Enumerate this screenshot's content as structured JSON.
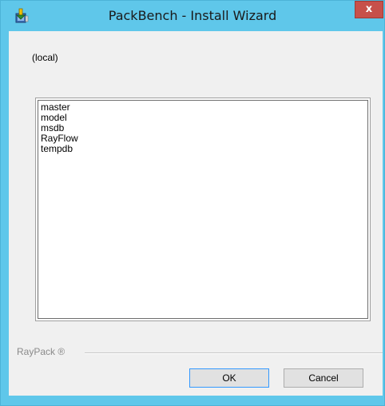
{
  "window": {
    "title": "PackBench - Install Wizard",
    "close_label": "x",
    "icon": "installer-icon"
  },
  "server": {
    "label": "(local)"
  },
  "database_list": {
    "items": [
      "master",
      "model",
      "msdb",
      "RayFlow",
      "tempdb"
    ]
  },
  "footer": {
    "brand": "RayPack ®",
    "ok_label": "OK",
    "cancel_label": "Cancel"
  },
  "colors": {
    "titlebar": "#5fc7ea",
    "close_button": "#c7504a",
    "client_background": "#f0f0f0"
  }
}
